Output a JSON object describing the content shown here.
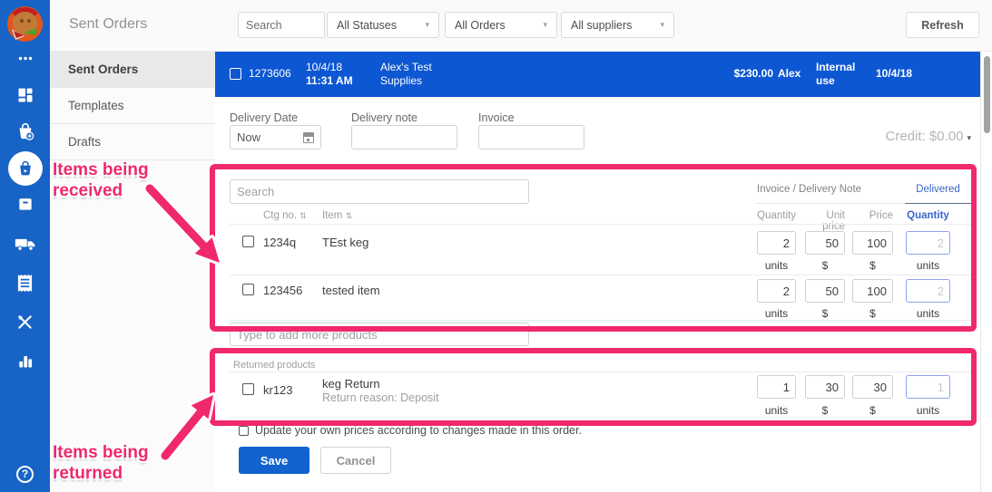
{
  "page_title": "Sent Orders",
  "topbar": {
    "search_placeholder": "Search",
    "filters": [
      "All Statuses",
      "All Orders",
      "All suppliers"
    ],
    "refresh_label": "Refresh"
  },
  "sidebar": {
    "icons": [
      "more-icon",
      "dashboard-icon",
      "new-order-icon",
      "sent-orders-icon",
      "inventory-icon",
      "delivery-truck-icon",
      "invoices-icon",
      "cookbook-icon",
      "reports-icon"
    ],
    "help": "?"
  },
  "subnav": {
    "items": [
      {
        "label": "Sent Orders",
        "active": true
      },
      {
        "label": "Templates",
        "active": false
      },
      {
        "label": "Drafts",
        "active": false
      }
    ]
  },
  "order_row": {
    "order_no": "1273606",
    "sent_date": "10/4/18",
    "sent_time": "11:31 AM",
    "supplier": "Alex's Test Supplies",
    "total": "$230.00",
    "user": "Alex",
    "note": "Internal use",
    "delivery_date": "10/4/18"
  },
  "detail": {
    "delivery_date_label": "Delivery Date",
    "delivery_date_value": "Now",
    "delivery_note_label": "Delivery note",
    "invoice_label": "Invoice",
    "credit_label": "Credit: $0.00",
    "items_search_placeholder": "Search",
    "group_header": "Invoice / Delivery Note",
    "delivered_header": "Delivered",
    "sort_glyph": "⇅",
    "columns": {
      "ctg": "Ctg no.",
      "item": "Item",
      "quantity": "Quantity",
      "unit_price": "Unit price",
      "price": "Price",
      "delivered_qty": "Quantity"
    },
    "unit_labels": {
      "qty": "units",
      "money": "$"
    },
    "items": [
      {
        "ctg": "1234q",
        "name": "TEst keg",
        "qty": "2",
        "unit_price": "50",
        "price": "100",
        "delivered": "2"
      },
      {
        "ctg": "123456",
        "name": "tested item",
        "qty": "2",
        "unit_price": "50",
        "price": "100",
        "delivered": "2"
      }
    ],
    "add_products_placeholder": "Type to add more products",
    "returned_label": "Returned products",
    "returned_item": {
      "ctg": "kr123",
      "name": "keg Return",
      "reason": "Return reason: Deposit",
      "qty": "1",
      "unit_price": "30",
      "price": "30",
      "delivered": "1"
    },
    "update_prices_label": "Update your own prices according to changes made in this order.",
    "save_label": "Save",
    "cancel_label": "Cancel"
  },
  "annotations": {
    "received": "Items being received",
    "returned": "Items being returned"
  },
  "glyphs": {
    "dropdown_arrow": "▾"
  },
  "colors": {
    "sidebar_blue": "#1863c6",
    "row_blue": "#0d57d2",
    "accent_pink": "#f0286e",
    "save_blue": "#1263cf"
  }
}
